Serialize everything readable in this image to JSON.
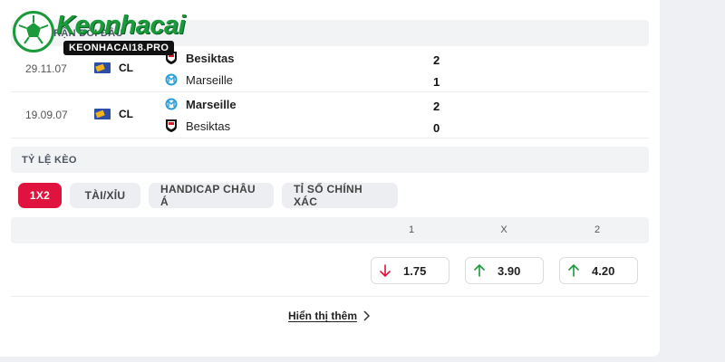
{
  "brand": {
    "name": "Keonhacai",
    "url": "KEONHACAI18.PRO"
  },
  "sections": {
    "history_title": "CÁC TRẬN ĐỐI ĐẦU",
    "odds_title": "TỶ LỆ KÈO"
  },
  "matches": [
    {
      "date": "29.11.07",
      "league": "CL",
      "home": {
        "name": "Besiktas",
        "score": "2"
      },
      "away": {
        "name": "Marseille",
        "score": "1"
      }
    },
    {
      "date": "19.09.07",
      "league": "CL",
      "home": {
        "name": "Marseille",
        "score": "2"
      },
      "away": {
        "name": "Besiktas",
        "score": "0"
      }
    }
  ],
  "tabs": [
    {
      "label": "1X2",
      "active": true
    },
    {
      "label": "TÀI/XỈU",
      "active": false
    },
    {
      "label": "HANDICAP CHÂU Á",
      "active": false
    },
    {
      "label": "TỈ SỐ CHÍNH XÁC",
      "active": false
    }
  ],
  "odds": {
    "headers": [
      "1",
      "X",
      "2"
    ],
    "values": [
      {
        "value": "1.75",
        "trend": "down",
        "color": "#e0123e"
      },
      {
        "value": "3.90",
        "trend": "up",
        "color": "#1a9a3a"
      },
      {
        "value": "4.20",
        "trend": "up",
        "color": "#1a9a3a"
      }
    ]
  },
  "show_more": "Hiển thị thêm",
  "colors": {
    "accent": "#e0123e",
    "up": "#1a9a3a",
    "down": "#e0123e",
    "brand": "#1a9a3a"
  },
  "icons": {
    "besiktas": "besiktas-crest-icon",
    "marseille": "marseille-crest-icon",
    "league": "champions-league-flag-icon",
    "chevron": "chevron-right-icon"
  }
}
